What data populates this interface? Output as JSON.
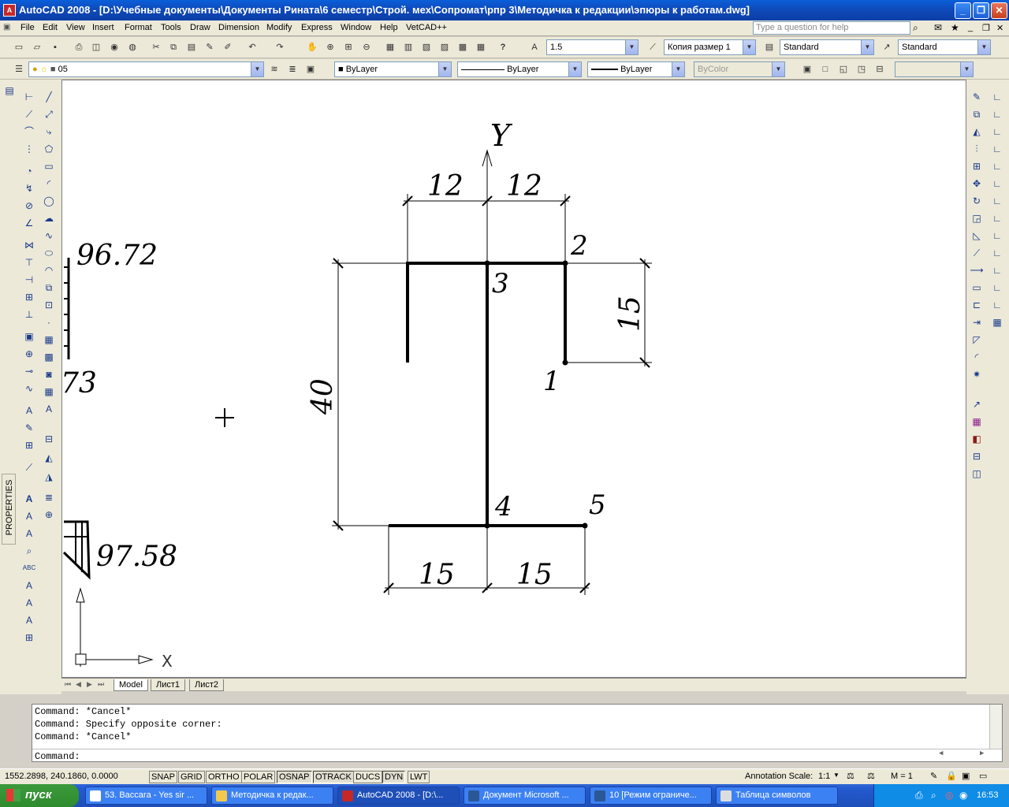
{
  "window": {
    "title": "AutoCAD 2008 - [D:\\Учебные документы\\Документы Рината\\6 семестр\\Строй. мех\\Сопромат\\рпр 3\\Методичка к редакции\\эпюры к работам.dwg]",
    "app_icon": "A"
  },
  "menu": {
    "items": [
      "File",
      "Edit",
      "View",
      "Insert",
      "Format",
      "Tools",
      "Draw",
      "Dimension",
      "Modify",
      "Express",
      "Window",
      "Help",
      "VetCAD++"
    ],
    "help_placeholder": "Type a question for help"
  },
  "toolbar": {
    "text_height": "1.5",
    "dim_style": "Копия размер 1",
    "text_style": "Standard",
    "table_style": "Standard",
    "layer": "05",
    "color": "ByLayer",
    "linetype": "ByLayer",
    "lineweight": "ByLayer",
    "plot_style": "ByColor"
  },
  "properties_tab": "PROPERTIES",
  "drawing": {
    "axis_label_y": "Y",
    "ucs_x": "X",
    "dims": {
      "top_left": "12",
      "top_right": "12",
      "right_flange": "15",
      "height": "40",
      "bottom_left": "15",
      "bottom_right": "15"
    },
    "points": [
      "1",
      "2",
      "3",
      "4",
      "5"
    ],
    "side_labels": {
      "top": "96.72",
      "middle": "73",
      "bottom": "97.58"
    }
  },
  "layout_tabs": [
    "Model",
    "Лист1",
    "Лист2"
  ],
  "command": {
    "history": [
      "Command: *Cancel*",
      "Command: Specify opposite corner:",
      "Command: *Cancel*"
    ],
    "prompt": "Command:"
  },
  "status": {
    "coords": "1552.2898, 240.1860, 0.0000",
    "toggles": [
      "SNAP",
      "GRID",
      "ORTHO",
      "POLAR",
      "OSNAP",
      "OTRACK",
      "DUCS",
      "DYN",
      "LWT"
    ],
    "annotation_scale_label": "Annotation Scale:",
    "annotation_scale": "1:1",
    "m_value": "M = 1"
  },
  "taskbar": {
    "start": "пуск",
    "tasks": [
      "53. Baccara - Yes sir ...",
      "Методичка к редак...",
      "AutoCAD 2008 - [D:\\...",
      "Документ Microsoft ...",
      "10 [Режим ограниче...",
      "Таблица символов"
    ],
    "lang": "EN",
    "clock": "16:53"
  }
}
